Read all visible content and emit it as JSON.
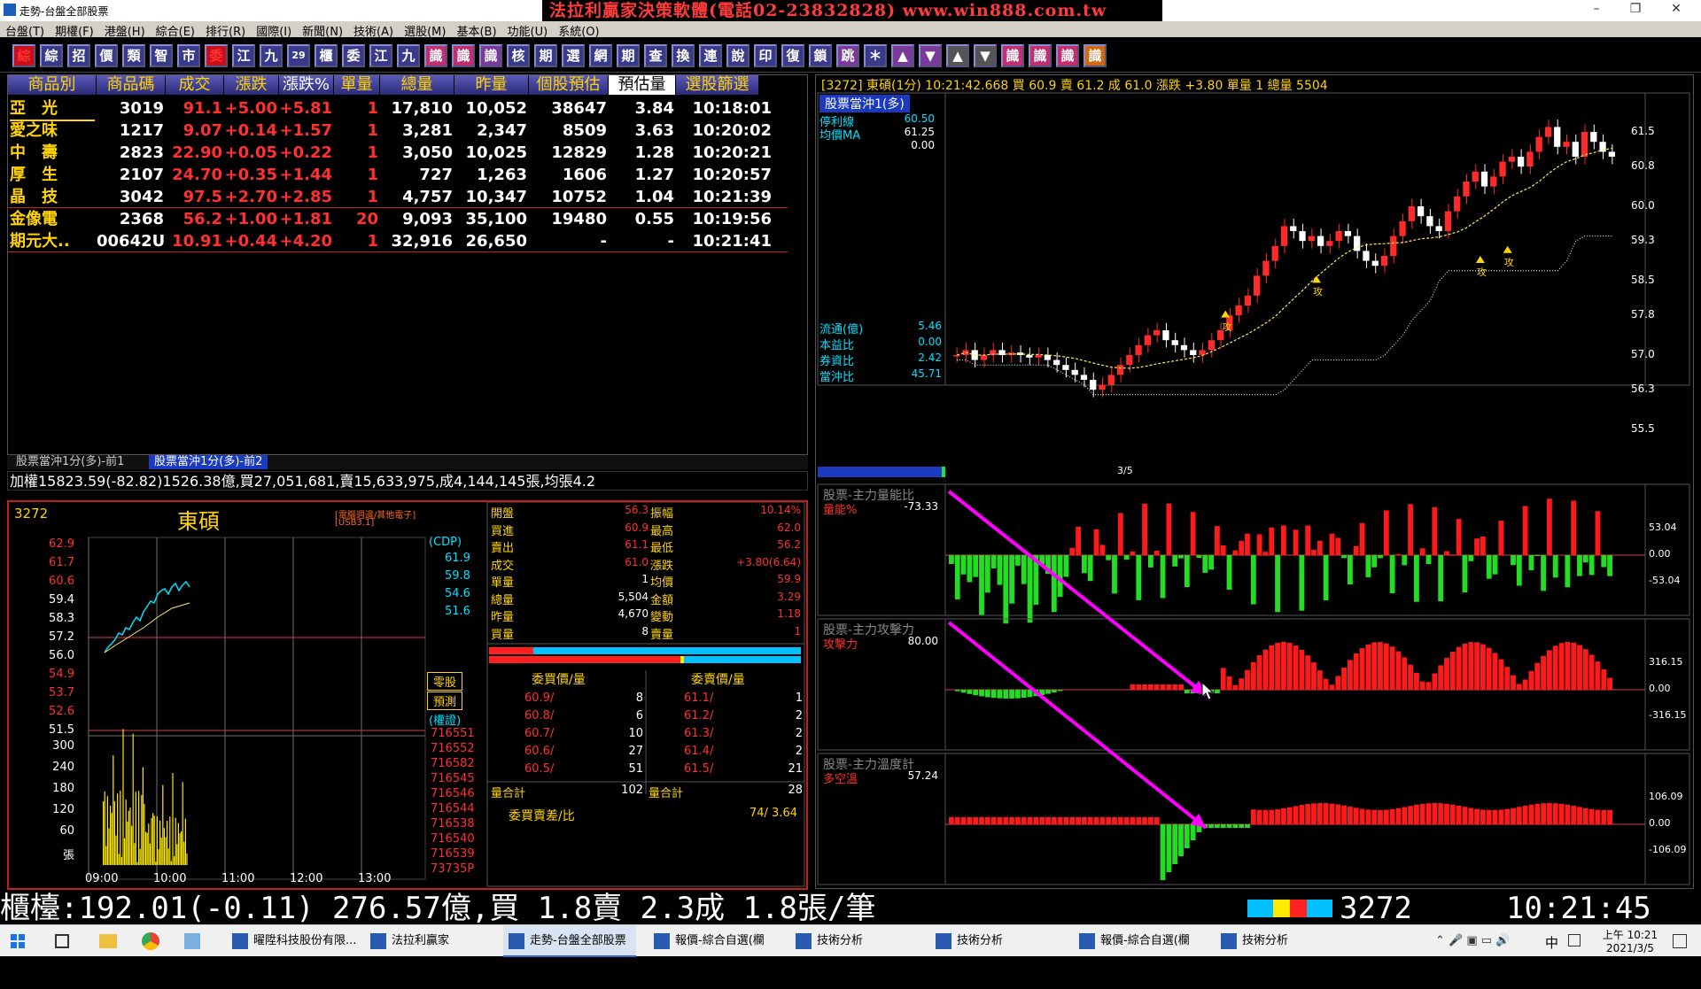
{
  "window": {
    "title": "走勢-台盤全部股票",
    "banner": "法拉利贏家決策軟體(電話02-23832828) www.win888.com.tw",
    "controls": [
      "–",
      "❐",
      "✕"
    ]
  },
  "menu": [
    "台盤(T)",
    "期權(F)",
    "港盤(H)",
    "綜合(E)",
    "排行(R)",
    "國際(I)",
    "新聞(N)",
    "技術(A)",
    "選股(M)",
    "基本(B)",
    "功能(U)",
    "系統(O)"
  ],
  "toolbar": [
    "綜",
    "綜",
    "招",
    "價",
    "類",
    "智",
    "市",
    "委",
    "江",
    "九",
    "29",
    "櫃",
    "委",
    "江",
    "九",
    "識",
    "識",
    "識",
    "核",
    "期",
    "選",
    "網",
    "期",
    "查",
    "換",
    "連",
    "說",
    "印",
    "復",
    "鎖",
    "跳",
    "＊",
    "▲",
    "▼",
    "▲",
    "▼",
    "識",
    "識",
    "識",
    "識"
  ],
  "quote_table": {
    "headers": [
      "商品別",
      "商品碼",
      "成交",
      "漲跌",
      "漲跌%",
      "單量",
      "總量",
      "昨量",
      "個股預估",
      "預估量",
      "選股篩選"
    ],
    "rows": [
      {
        "name": "亞　光",
        "code": "3019",
        "price": "91.1",
        "chg": "+5.00",
        "pct": "+5.81",
        "vol": "1",
        "total": "17,810",
        "yvol": "10,052",
        "est": "38647",
        "ratio": "3.84",
        "time": "10:18:01"
      },
      {
        "name": "愛之味",
        "code": "1217",
        "price": "9.07",
        "chg": "+0.14",
        "pct": "+1.57",
        "vol": "1",
        "total": "3,281",
        "yvol": "2,347",
        "est": "8509",
        "ratio": "3.63",
        "time": "10:20:02"
      },
      {
        "name": "中　壽",
        "code": "2823",
        "price": "22.90",
        "chg": "+0.05",
        "pct": "+0.22",
        "vol": "1",
        "total": "3,050",
        "yvol": "10,025",
        "est": "12829",
        "ratio": "1.28",
        "time": "10:20:21"
      },
      {
        "name": "厚　生",
        "code": "2107",
        "price": "24.70",
        "chg": "+0.35",
        "pct": "+1.44",
        "vol": "1",
        "total": "727",
        "yvol": "1,263",
        "est": "1606",
        "ratio": "1.27",
        "time": "10:20:57"
      },
      {
        "name": "晶　技",
        "code": "3042",
        "price": "97.5",
        "chg": "+2.70",
        "pct": "+2.85",
        "vol": "1",
        "total": "4,757",
        "yvol": "10,347",
        "est": "10752",
        "ratio": "1.04",
        "time": "10:21:39"
      },
      {
        "name": "金像電",
        "code": "2368",
        "price": "56.2",
        "chg": "+1.00",
        "pct": "+1.81",
        "vol": "20",
        "total": "9,093",
        "yvol": "35,100",
        "est": "19480",
        "ratio": "0.55",
        "time": "10:19:56"
      },
      {
        "name": "期元大..",
        "code": "00642U",
        "price": "10.91",
        "chg": "+0.44",
        "pct": "+4.20",
        "vol": "1",
        "total": "32,916",
        "yvol": "26,650",
        "est": "-",
        "ratio": "-",
        "time": "10:21:41"
      }
    ]
  },
  "tabs": [
    "股票當沖1分(多)-前1",
    "股票當沖1分(多)-前2"
  ],
  "index_line": "加權15823.59(-82.82)1526.38億,買27,051,681,賣15,633,975,成4,144,145張,均張4.2",
  "mini": {
    "code": "3272",
    "name": "東碩",
    "note1": "[電腦週邊/其他電子]",
    "note2": "[USB3.1]",
    "yticks": [
      "62.9",
      "61.7",
      "60.6",
      "59.4",
      "58.3",
      "57.2",
      "56.0",
      "54.9",
      "53.7",
      "52.6",
      "51.5"
    ],
    "vticks": [
      "300",
      "240",
      "180",
      "120",
      "60",
      "張"
    ],
    "xticks": [
      "09:00",
      "10:00",
      "11:00",
      "12:00",
      "13:00"
    ],
    "cdp_label": "(CDP)",
    "cdp": [
      "61.9",
      "59.8",
      "54.6",
      "51.6"
    ],
    "btn1": "零股",
    "btn2": "預測",
    "warrant_label": "(權證)",
    "warrant": [
      "716551",
      "716552",
      "716582",
      "716545",
      "716546",
      "716544",
      "716538",
      "716540",
      "716539",
      "73735P"
    ],
    "stats_left": [
      [
        "開盤",
        "56.3"
      ],
      [
        "買進",
        "60.9"
      ],
      [
        "賣出",
        "61.1"
      ],
      [
        "成交",
        "61.0"
      ],
      [
        "單量",
        "1"
      ],
      [
        "總量",
        "5,504"
      ],
      [
        "昨量",
        "4,670"
      ],
      [
        "買量",
        "8"
      ]
    ],
    "stats_right": [
      [
        "振幅",
        "10.14%"
      ],
      [
        "最高",
        "62.0"
      ],
      [
        "最低",
        "56.2"
      ],
      [
        "漲跌",
        "+3.80(6.64)"
      ],
      [
        "均價",
        "59.9"
      ],
      [
        "金額",
        "3.29"
      ],
      [
        "變動",
        "1.18"
      ],
      [
        "賣量",
        "1"
      ]
    ],
    "book_hdr_buy": "委買價/量",
    "book_hdr_sell": "委賣價/量",
    "book_buy": [
      [
        "60.9/",
        "8"
      ],
      [
        "60.8/",
        "6"
      ],
      [
        "60.7/",
        "10"
      ],
      [
        "60.6/",
        "27"
      ],
      [
        "60.5/",
        "51"
      ]
    ],
    "book_sell": [
      [
        "61.1/",
        "1"
      ],
      [
        "61.2/",
        "2"
      ],
      [
        "61.3/",
        "2"
      ],
      [
        "61.4/",
        "2"
      ],
      [
        "61.5/",
        "21"
      ]
    ],
    "buy_total_label": "量合計",
    "buy_total": "102",
    "sell_total_label": "量合計",
    "sell_total": "28",
    "ratio_label": "委買賣差/比",
    "ratio_value": "74/ 3.64"
  },
  "chart": {
    "header": "[3272] 東碩(1分)   10:21:42.668 買 60.9 賣 61.2 成 61.0 漲跌 +3.80 單量 1 總量 5504",
    "strategy": "股票當沖1(多)",
    "stop_label": "停利線",
    "stop_value": "60.50",
    "ma_label": "均價MA",
    "ma_value": "61.25",
    "zero_value": "0.00",
    "left_stats": [
      [
        "流通(億)",
        "5.46"
      ],
      [
        "本益比",
        "0.00"
      ],
      [
        "券資比",
        "2.42"
      ],
      [
        "當沖比",
        "45.71"
      ]
    ],
    "yticks": [
      "61.5",
      "60.8",
      "60.0",
      "59.3",
      "58.5",
      "57.8",
      "57.0",
      "56.3",
      "55.5"
    ],
    "date": "3/5",
    "signal_label": "攻",
    "p1_title": "股票-主力量能比",
    "p1_series": "量能%",
    "p1_value": "-73.33",
    "p1_ticks": [
      "53.04",
      "0.00",
      "-53.04"
    ],
    "p2_title": "股票-主力攻擊力",
    "p2_series": "攻擊力",
    "p2_value": "80.00",
    "p2_ticks": [
      "316.15",
      "0.00",
      "-316.15"
    ],
    "p3_title": "股票-主力溫度計",
    "p3_series": "多空溫",
    "p3_value": "57.24",
    "p3_ticks": [
      "106.09",
      "0.00",
      "-106.09"
    ],
    "accent": "#ff00ff"
  },
  "bottom_ticker": "櫃檯:192.01(-0.11) 276.57億,買 1.8賣 2.3成 1.8張/筆",
  "bottom_code": "3272",
  "bottom_time": "10:21:45",
  "taskbar": {
    "items": [
      "曜陞科技股份有限...",
      "法拉利贏家",
      "走勢-台盤全部股票",
      "報價-綜合自選(欄位...",
      "技術分析",
      "技術分析",
      "報價-綜合自選(欄位...",
      "技術分析"
    ],
    "ime": "中",
    "clock_time": "上午 10:21",
    "clock_date": "2021/3/5"
  }
}
